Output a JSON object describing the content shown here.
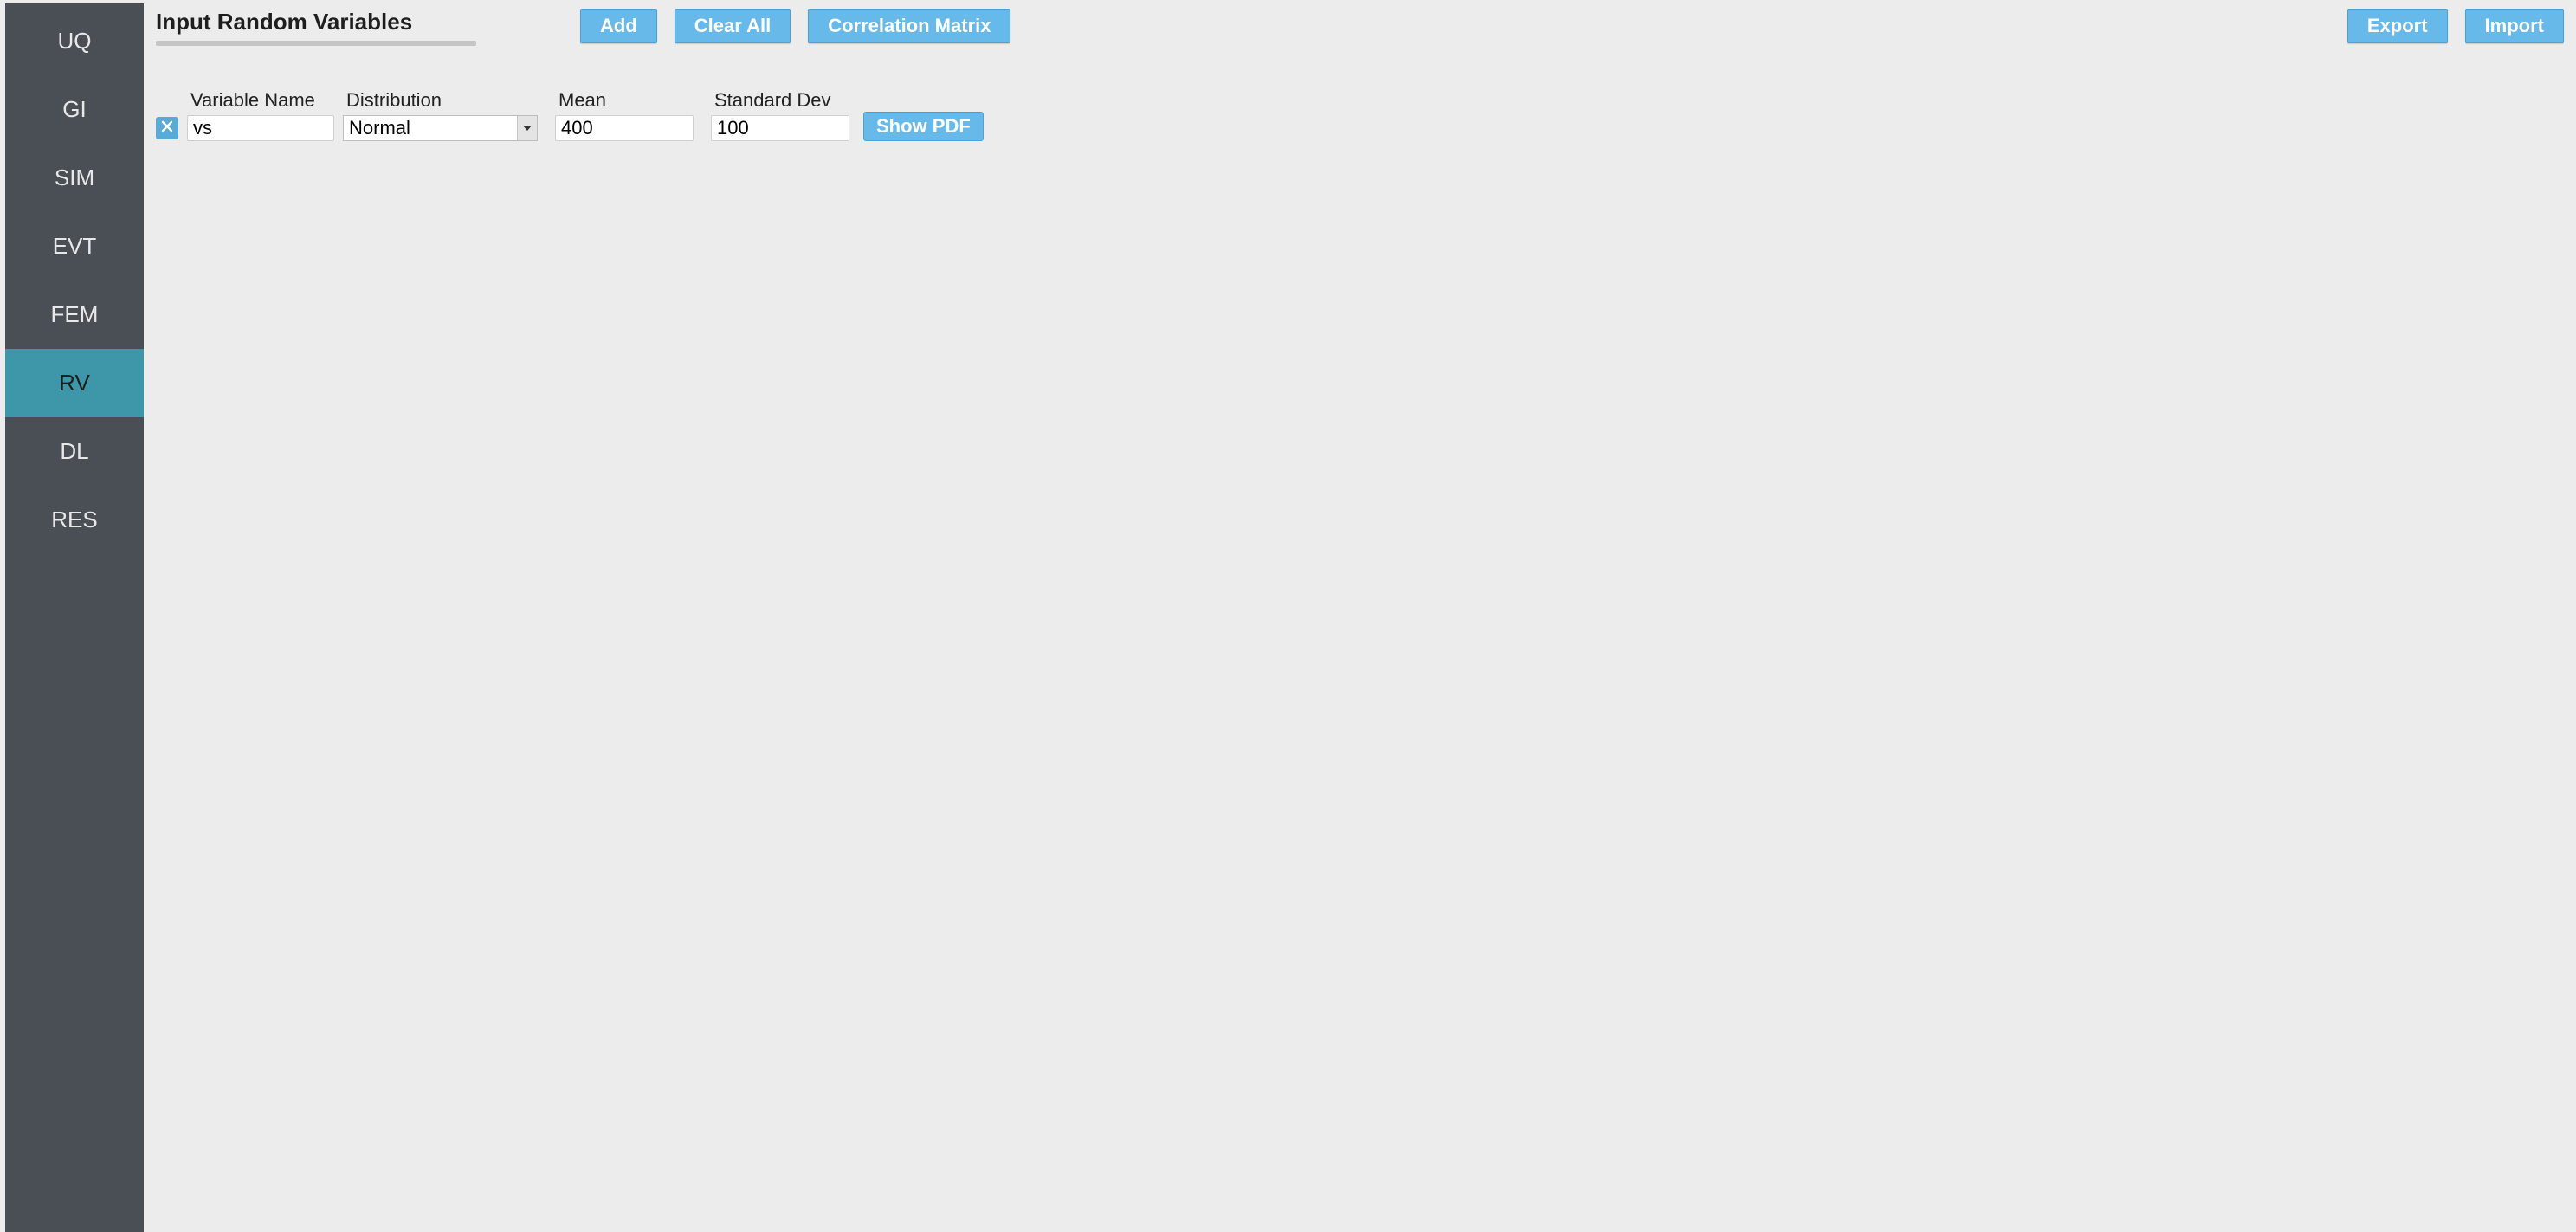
{
  "sidebar": {
    "items": [
      {
        "id": "uq",
        "label": "UQ",
        "active": false
      },
      {
        "id": "gi",
        "label": "GI",
        "active": false
      },
      {
        "id": "sim",
        "label": "SIM",
        "active": false
      },
      {
        "id": "evt",
        "label": "EVT",
        "active": false
      },
      {
        "id": "fem",
        "label": "FEM",
        "active": false
      },
      {
        "id": "rv",
        "label": "RV",
        "active": true
      },
      {
        "id": "dl",
        "label": "DL",
        "active": false
      },
      {
        "id": "res",
        "label": "RES",
        "active": false
      }
    ]
  },
  "header": {
    "title": "Input Random Variables",
    "buttons": {
      "add": "Add",
      "clear_all": "Clear All",
      "correlation_matrix": "Correlation Matrix",
      "export": "Export",
      "import": "Import"
    }
  },
  "columns": {
    "variable_name": "Variable Name",
    "distribution": "Distribution",
    "mean": "Mean",
    "standard_dev": "Standard Dev"
  },
  "distribution_options": [
    "Normal"
  ],
  "variables": [
    {
      "name": "vs",
      "distribution": "Normal",
      "mean": "400",
      "std": "100",
      "show_pdf_label": "Show PDF"
    }
  ]
}
